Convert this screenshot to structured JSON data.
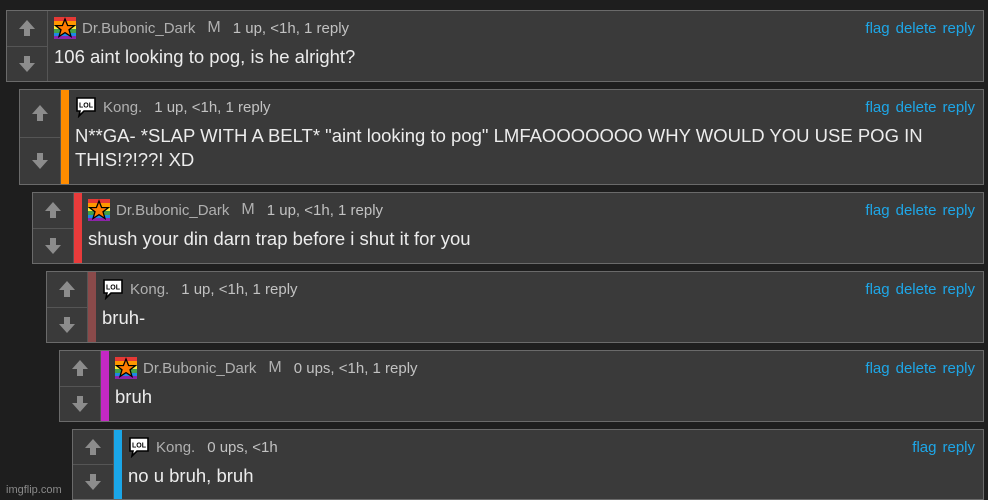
{
  "actions": {
    "flag": "flag",
    "delete": "delete",
    "reply": "reply"
  },
  "watermark": "imgflip.com",
  "comments": [
    {
      "username": "Dr.Bubonic_Dark",
      "badge": "M",
      "stats": "1 up, <1h, 1 reply",
      "text": "106 aint looking to pog, is he alright?",
      "avatar": "rainbow-star-icon",
      "accent_color": null,
      "show_delete": true
    },
    {
      "username": "Kong.",
      "badge": "",
      "stats": "1 up, <1h, 1 reply",
      "text": "N**GA- *SLAP WITH A BELT* \"aint looking to pog\" LMFAOOOOOOO WHY WOULD YOU USE POG IN THIS!?!??! XD",
      "avatar": "lol-speech-bubble-icon",
      "accent_color": "#ff8c00",
      "show_delete": true
    },
    {
      "username": "Dr.Bubonic_Dark",
      "badge": "M",
      "stats": "1 up, <1h, 1 reply",
      "text": "shush your din darn trap before i shut it for you",
      "avatar": "rainbow-star-icon",
      "accent_color": "#e83b3b",
      "show_delete": true
    },
    {
      "username": "Kong.",
      "badge": "",
      "stats": "1 up, <1h, 1 reply",
      "text": "bruh-",
      "avatar": "lol-speech-bubble-icon",
      "accent_color": "#8a4a4a",
      "show_delete": true
    },
    {
      "username": "Dr.Bubonic_Dark",
      "badge": "M",
      "stats": "0 ups, <1h, 1 reply",
      "text": "bruh",
      "avatar": "rainbow-star-icon",
      "accent_color": "#c428c4",
      "show_delete": true
    },
    {
      "username": "Kong.",
      "badge": "",
      "stats": "0 ups, <1h",
      "text": "no u bruh, bruh",
      "avatar": "lol-speech-bubble-icon",
      "accent_color": "#1aa6e8",
      "show_delete": false
    }
  ]
}
